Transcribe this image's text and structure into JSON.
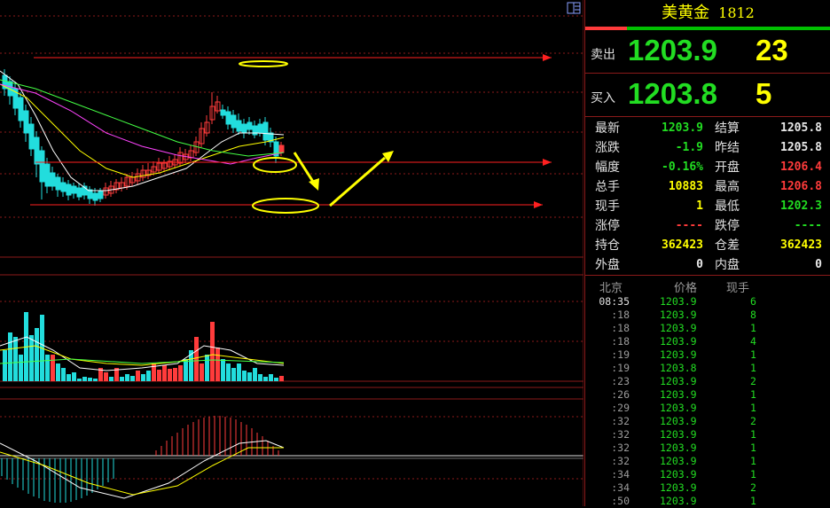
{
  "title": {
    "name": "美黄金",
    "code": "1812"
  },
  "ask": {
    "label": "卖出",
    "price": "1203.9",
    "volume": "23"
  },
  "bid": {
    "label": "买入",
    "price": "1203.8",
    "volume": "5"
  },
  "stats": [
    {
      "k1": "最新",
      "v1": "1203.9",
      "c1": "g",
      "k2": "结算",
      "v2": "1205.8",
      "c2": "w"
    },
    {
      "k1": "涨跌",
      "v1": "-1.9",
      "c1": "g",
      "k2": "昨结",
      "v2": "1205.8",
      "c2": "w"
    },
    {
      "k1": "幅度",
      "v1": "-0.16%",
      "c1": "g",
      "k2": "开盘",
      "v2": "1206.4",
      "c2": "r"
    },
    {
      "k1": "总手",
      "v1": "10883",
      "c1": "y",
      "k2": "最高",
      "v2": "1206.8",
      "c2": "r"
    },
    {
      "k1": "现手",
      "v1": "1",
      "c1": "y",
      "k2": "最低",
      "v2": "1202.3",
      "c2": "g"
    },
    {
      "k1": "涨停",
      "v1": "----",
      "c1": "r",
      "k2": "跌停",
      "v2": "----",
      "c2": "g"
    },
    {
      "k1": "持仓",
      "v1": "362423",
      "c1": "y",
      "k2": "仓差",
      "v2": "362423",
      "c2": "y"
    },
    {
      "k1": "外盘",
      "v1": "0",
      "c1": "w",
      "k2": "内盘",
      "v2": "0",
      "c2": "w"
    }
  ],
  "ticks_header": {
    "time": "北京",
    "price": "价格",
    "volume": "现手"
  },
  "ticks": [
    {
      "time": "08:35",
      "price": "1203.9",
      "vol": "6"
    },
    {
      "time": ":18",
      "price": "1203.9",
      "vol": "8"
    },
    {
      "time": ":18",
      "price": "1203.9",
      "vol": "1"
    },
    {
      "time": ":18",
      "price": "1203.9",
      "vol": "4"
    },
    {
      "time": ":19",
      "price": "1203.9",
      "vol": "1"
    },
    {
      "time": ":19",
      "price": "1203.8",
      "vol": "1"
    },
    {
      "time": ":23",
      "price": "1203.9",
      "vol": "2"
    },
    {
      "time": ":26",
      "price": "1203.9",
      "vol": "1"
    },
    {
      "time": ":29",
      "price": "1203.9",
      "vol": "1"
    },
    {
      "time": ":32",
      "price": "1203.9",
      "vol": "2"
    },
    {
      "time": ":32",
      "price": "1203.9",
      "vol": "1"
    },
    {
      "time": ":32",
      "price": "1203.9",
      "vol": "1"
    },
    {
      "time": ":32",
      "price": "1203.9",
      "vol": "1"
    },
    {
      "time": ":34",
      "price": "1203.9",
      "vol": "1"
    },
    {
      "time": ":34",
      "price": "1203.9",
      "vol": "2"
    },
    {
      "time": ":50",
      "price": "1203.9",
      "vol": "1"
    }
  ],
  "colors": {
    "up": "#ff3b3b",
    "down": "#22dddd",
    "price_green": "#22dd22",
    "highlight": "#ffff00",
    "grid": "#8b1a1a"
  },
  "icons": {
    "layout": "layout-toggle-icon"
  }
}
